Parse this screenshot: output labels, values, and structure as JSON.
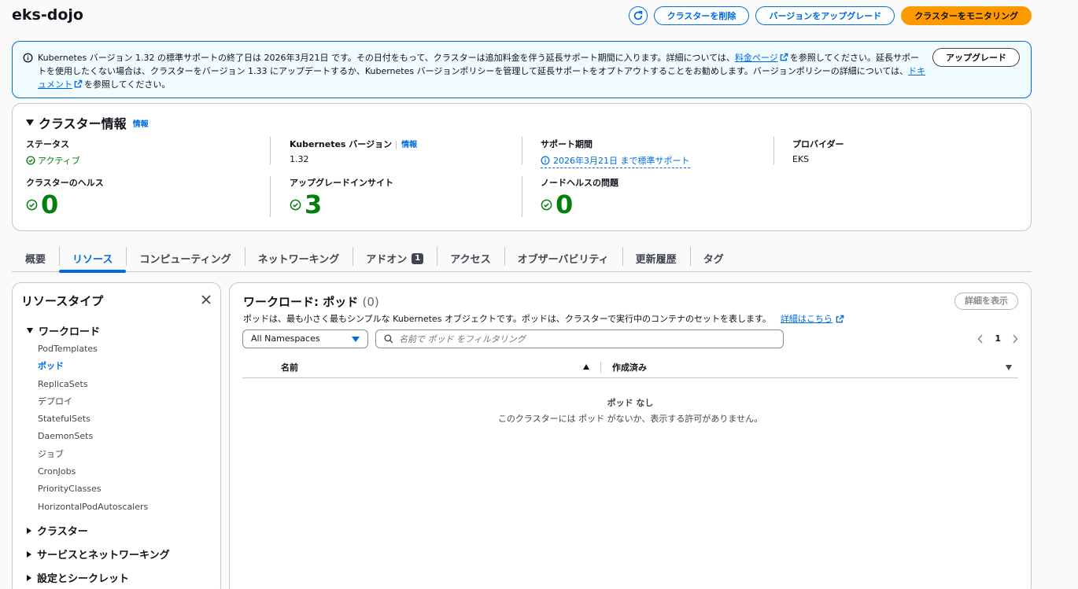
{
  "header": {
    "title": "eks-dojo",
    "delete_label": "クラスターを削除",
    "upgrade_label": "バージョンをアップグレード",
    "monitor_label": "クラスターをモニタリング"
  },
  "alert": {
    "text_1": "Kubernetes バージョン 1.32 の標準サポートの終了日は 2026年3月21日 です。その日付をもって、クラスターは追加料金を伴う延長サポート期間に入ります。詳細については、",
    "link_1": "料金ページ",
    "text_2": "を参照してください。延長サポートを使用したくない場合は、クラスターをバージョン 1.33 にアップデートするか、Kubernetes バージョンポリシーを管理して延長サポートをオプトアウトすることをお勧めします。バージョンポリシーの詳細については、",
    "link_2": "ドキュメント",
    "text_3": "を参照してください。",
    "button_label": "アップグレード"
  },
  "cluster_info": {
    "title": "クラスター情報",
    "info_link": "情報",
    "status_label": "ステータス",
    "status_value": "アクティブ",
    "k8s_label": "Kubernetes バージョン",
    "k8s_info": "情報",
    "k8s_value": "1.32",
    "support_label": "サポート期間",
    "support_value": "2026年3月21日 まで標準サポート",
    "provider_label": "プロバイダー",
    "provider_value": "EKS",
    "health_label": "クラスターのヘルス",
    "health_value": "0",
    "insights_label": "アップグレードインサイト",
    "insights_value": "3",
    "node_label": "ノードヘルスの問題",
    "node_value": "0"
  },
  "tabs": [
    {
      "label": "概要"
    },
    {
      "label": "リソース"
    },
    {
      "label": "コンピューティング"
    },
    {
      "label": "ネットワーキング"
    },
    {
      "label": "アドオン",
      "badge": "1"
    },
    {
      "label": "アクセス"
    },
    {
      "label": "オブザーバビリティ"
    },
    {
      "label": "更新履歴"
    },
    {
      "label": "タグ"
    }
  ],
  "resource_types": {
    "title": "リソースタイプ",
    "workloads": "ワークロード",
    "items": [
      "PodTemplates",
      "ポッド",
      "ReplicaSets",
      "デプロイ",
      "StatefulSets",
      "DaemonSets",
      "ジョブ",
      "CronJobs",
      "PriorityClasses",
      "HorizontalPodAutoscalers"
    ],
    "cluster": "クラスター",
    "services": "サービスとネットワーキング",
    "config": "設定とシークレット"
  },
  "workload": {
    "title": "ワークロード: ポッド",
    "count": "(0)",
    "description": "ポッドは、最も小さく最もシンプルな Kubernetes オブジェクトです。ポッドは、クラスターで実行中のコンテナのセットを表します。",
    "learn_more": "詳細はこちら",
    "details_button": "詳細を表示",
    "namespace": "All Namespaces",
    "search_placeholder": "名前で ポッド をフィルタリング",
    "page": "1",
    "col_name": "名前",
    "col_created": "作成済み",
    "empty_title": "ポッド なし",
    "empty_desc": "このクラスターには ポッド がないか、表示する許可がありません。"
  },
  "colors": {
    "accent": "#006ce0",
    "primary_button": "#ff9900",
    "success": "#037f0c"
  }
}
